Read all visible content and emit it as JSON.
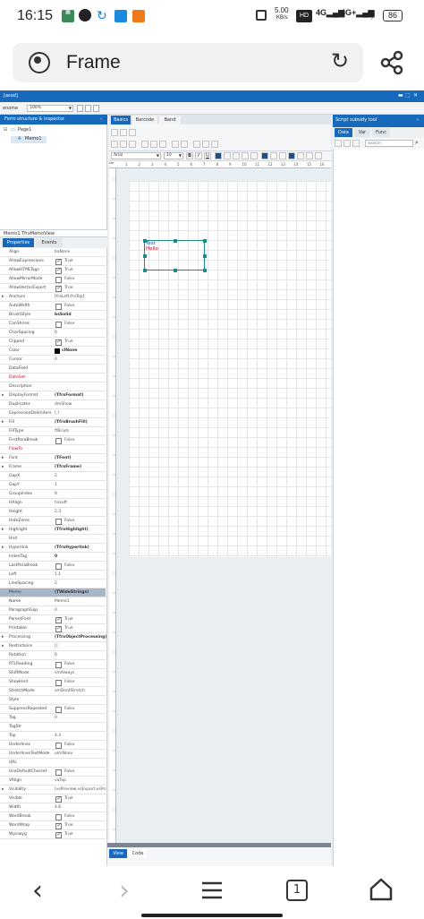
{
  "status_bar": {
    "time": "16:15",
    "speed_value": "5.00",
    "speed_unit": "KB/s",
    "battery": "86"
  },
  "browser": {
    "title": "Frame"
  },
  "app": {
    "window_title": "[asod]",
    "zoom_label": "enome",
    "zoom_value": "100%",
    "left_panel_title": "Form structure & inspector",
    "tree": [
      {
        "label": "Page1"
      },
      {
        "label": "Memo1"
      }
    ],
    "inspector_object": "Memo1 TfrxMemoView",
    "inspector_tabs": [
      "Properties",
      "Events"
    ],
    "designer_tabs": [
      "Basics",
      "Barcode",
      "Band"
    ],
    "font_name": "Arial",
    "font_size": "10",
    "script_title": "Script subsidy tool",
    "script_tabs": [
      "Data",
      "Var",
      "Func"
    ],
    "search_placeholder": "search",
    "memo_lines": [
      "Test",
      "Hello"
    ],
    "bottom_tabs": [
      "View",
      "Code"
    ],
    "ruler_numbers": [
      "1",
      "2",
      "3",
      "4",
      "5",
      "6",
      "7",
      "8",
      "9",
      "10",
      "11",
      "12",
      "13",
      "14",
      "15",
      "16"
    ],
    "properties": [
      {
        "k": "Align",
        "v": "baNone"
      },
      {
        "k": "AllowExpressions",
        "cb": true,
        "v": "True"
      },
      {
        "k": "AllowHTMLTags",
        "cb": true,
        "v": "True"
      },
      {
        "k": "AllowMirrorMode",
        "cb": false,
        "v": "False"
      },
      {
        "k": "AllowVectorExport",
        "cb": true,
        "v": "True"
      },
      {
        "k": "Anchors",
        "v": "[fraLeft,fraTop]",
        "exp": true
      },
      {
        "k": "AutoWidth",
        "cb": false,
        "v": "False"
      },
      {
        "k": "BrushStyle",
        "v": "bsSolid",
        "bold": true
      },
      {
        "k": "CanShrink",
        "cb": false,
        "v": "False"
      },
      {
        "k": "CharSpacing",
        "v": "0"
      },
      {
        "k": "Clipped",
        "cb": true,
        "v": "True"
      },
      {
        "k": "Color",
        "v": "clNone",
        "bold": true,
        "swatch": true
      },
      {
        "k": "Cursor",
        "v": "0"
      },
      {
        "k": "DataField",
        "v": ""
      },
      {
        "k": "DataSet",
        "v": "",
        "red": true
      },
      {
        "k": "Description",
        "v": ""
      },
      {
        "k": "DisplayFormat",
        "v": "(TfrxFormat)",
        "bold": true,
        "exp": true
      },
      {
        "k": "Duplicates",
        "v": "dmShow"
      },
      {
        "k": "ExpressionDelimiters",
        "v": "[,]"
      },
      {
        "k": "Fill",
        "v": "(TfrxBrushFill)",
        "bold": true,
        "exp": true
      },
      {
        "k": "FillType",
        "v": "ftBrush"
      },
      {
        "k": "FirstParaBreak",
        "cb": false,
        "v": "False"
      },
      {
        "k": "FlowTo",
        "v": "",
        "red": true
      },
      {
        "k": "Font",
        "v": "(TFont)",
        "bold": true,
        "exp": true
      },
      {
        "k": "Frame",
        "v": "(TfrxFrame)",
        "bold": true,
        "exp": true
      },
      {
        "k": "GapX",
        "v": "2"
      },
      {
        "k": "GapY",
        "v": "1"
      },
      {
        "k": "GroupIndex",
        "v": "0"
      },
      {
        "k": "HAlign",
        "v": "haLeft"
      },
      {
        "k": "Height",
        "v": "2.3"
      },
      {
        "k": "HideZeros",
        "cb": false,
        "v": "False"
      },
      {
        "k": "Highlight",
        "v": "(TfrxHighlight)",
        "bold": true,
        "exp": true
      },
      {
        "k": "Hint",
        "v": ""
      },
      {
        "k": "Hyperlink",
        "v": "(TfrxHyperlink)",
        "bold": true,
        "exp": true
      },
      {
        "k": "IndexTag",
        "v": "0",
        "bold": true
      },
      {
        "k": "LastParaBreak",
        "cb": false,
        "v": "False"
      },
      {
        "k": "Left",
        "v": "1.1"
      },
      {
        "k": "LineSpacing",
        "v": "2"
      },
      {
        "k": "Memo",
        "v": "(TWideStrings)",
        "bold": true,
        "sel": true
      },
      {
        "k": "Name",
        "v": "Memo1"
      },
      {
        "k": "ParagraphGap",
        "v": "0"
      },
      {
        "k": "ParentFont",
        "cb": true,
        "v": "True"
      },
      {
        "k": "Printable",
        "cb": true,
        "v": "True"
      },
      {
        "k": "Processing",
        "v": "(TfrxObjectProcessing)",
        "bold": true,
        "exp": true
      },
      {
        "k": "Restrictions",
        "v": "[]",
        "exp": true
      },
      {
        "k": "Rotation",
        "v": "0"
      },
      {
        "k": "RTLReading",
        "cb": false,
        "v": "False"
      },
      {
        "k": "ShiftMode",
        "v": "smAlways"
      },
      {
        "k": "ShowHint",
        "cb": false,
        "v": "False"
      },
      {
        "k": "StretchMode",
        "v": "smDontStretch"
      },
      {
        "k": "Style",
        "v": ""
      },
      {
        "k": "SuppressRepeated",
        "cb": false,
        "v": "False"
      },
      {
        "k": "Tag",
        "v": "0"
      },
      {
        "k": "TagStr",
        "v": ""
      },
      {
        "k": "Top",
        "v": "4.4"
      },
      {
        "k": "Underlines",
        "cb": false,
        "v": "False"
      },
      {
        "k": "UnderlinesTextMode",
        "v": "ulmNone"
      },
      {
        "k": "URL",
        "v": ""
      },
      {
        "k": "UseDefaultCharset",
        "cb": false,
        "v": "False"
      },
      {
        "k": "VAlign",
        "v": "vaTop"
      },
      {
        "k": "Visibility",
        "v": "[vsPreview,vsExport,vsPrint]",
        "exp": true
      },
      {
        "k": "Visible",
        "cb": true,
        "v": "True"
      },
      {
        "k": "Width",
        "v": "4.6"
      },
      {
        "k": "WordBreak",
        "cb": false,
        "v": "False"
      },
      {
        "k": "WordWrap",
        "cb": true,
        "v": "True"
      },
      {
        "k": "Wysiwyg",
        "cb": true,
        "v": "True"
      }
    ]
  },
  "colors": {
    "accent": "#1669bb",
    "memo_border": "#1a8a8a",
    "memo_text": "#d0021b"
  }
}
